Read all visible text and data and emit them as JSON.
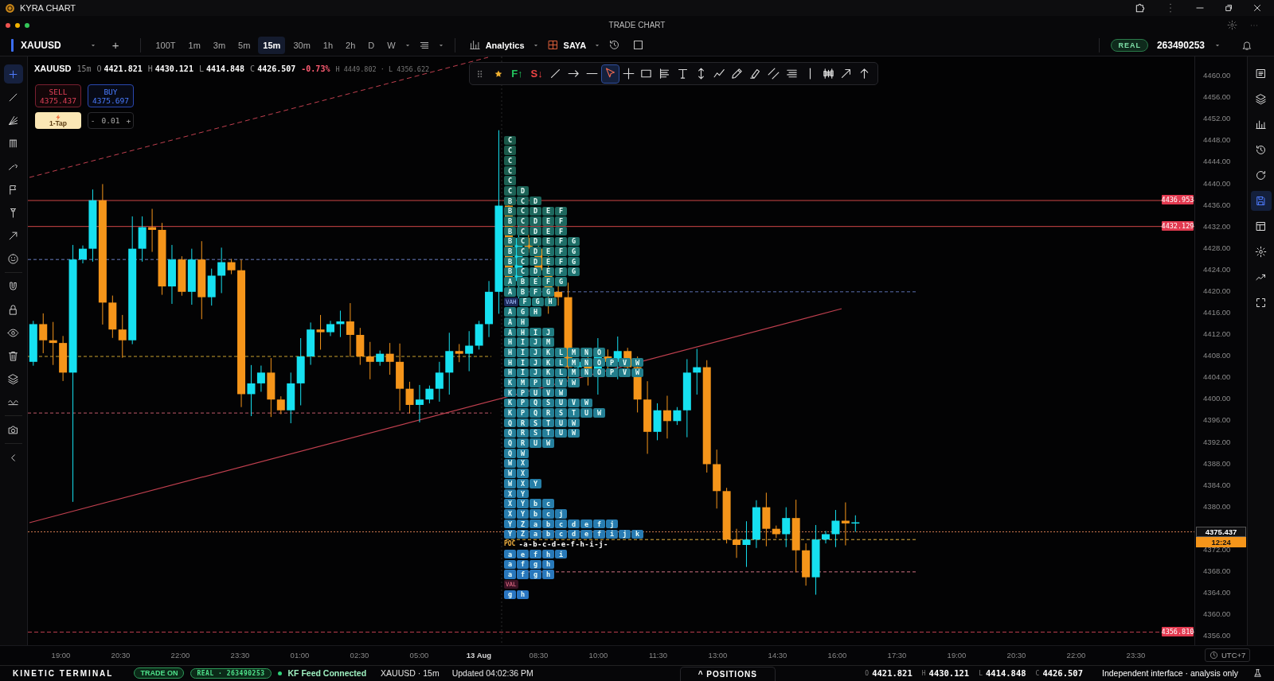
{
  "app_title": "KYRA CHART",
  "window_title": "TRADE CHART",
  "toolbar": {
    "symbol": "XAUUSD",
    "add": "+",
    "intervals": [
      {
        "label": "100T",
        "selected": false
      },
      {
        "label": "1m",
        "selected": false
      },
      {
        "label": "3m",
        "selected": false
      },
      {
        "label": "5m",
        "selected": false
      },
      {
        "label": "15m",
        "selected": true
      },
      {
        "label": "30m",
        "selected": false
      },
      {
        "label": "1h",
        "selected": false
      },
      {
        "label": "2h",
        "selected": false
      },
      {
        "label": "D",
        "selected": false
      },
      {
        "label": "W",
        "selected": false
      }
    ],
    "analytics": "Analytics",
    "layout_name": "SAYA",
    "account_badge": "REAL",
    "account_id": "263490253"
  },
  "left_tools": [
    {
      "selected": true
    },
    {
      "selected": false
    },
    {
      "selected": false
    },
    {
      "selected": false
    },
    {
      "selected": false
    },
    {
      "selected": false
    },
    {
      "selected": false
    },
    {
      "selected": false
    },
    {
      "selected": false
    },
    {
      "selected": false
    },
    {
      "selected": false
    },
    {
      "selected": false
    },
    {
      "selected": false
    },
    {
      "selected": false
    },
    {
      "selected": false
    },
    {
      "selected": false
    },
    {
      "selected": false
    }
  ],
  "right_tools": [
    {
      "selected": false
    },
    {
      "selected": false
    },
    {
      "selected": false
    },
    {
      "selected": false
    },
    {
      "selected": false
    },
    {
      "selected": true
    },
    {
      "selected": false
    },
    {
      "selected": false
    },
    {
      "selected": false
    },
    {
      "selected": false
    }
  ],
  "legend": {
    "symbol": "XAUUSD",
    "interval": "15m",
    "values": [
      {
        "key": "O",
        "value": "4421.821"
      },
      {
        "key": "H",
        "value": "4430.121"
      },
      {
        "key": "L",
        "value": "4414.848"
      },
      {
        "key": "C",
        "value": "4426.507"
      }
    ],
    "change": "-0.73%",
    "range": "H 4449.802 · L 4356.622"
  },
  "trade": {
    "sell_label": "SELL",
    "sell_price": "4375.437",
    "buy_label": "BUY",
    "buy_price": "4375.697",
    "one_tap": "1-Tap",
    "qty_minus": "-",
    "qty": "0.01",
    "qty_plus": "+"
  },
  "drawing_tools": [
    {
      "selected": false
    },
    {
      "label": "F↑",
      "color": "#22c55e",
      "selected": false
    },
    {
      "label": "S↓",
      "color": "#ef4444",
      "selected": false
    },
    {
      "selected": false
    },
    {
      "selected": false
    },
    {
      "selected": false
    },
    {
      "selected": true
    },
    {
      "selected": false
    },
    {
      "selected": false
    },
    {
      "selected": false
    },
    {
      "selected": false
    },
    {
      "selected": false
    },
    {
      "selected": false
    },
    {
      "selected": false
    },
    {
      "selected": false
    },
    {
      "selected": false
    },
    {
      "selected": false
    },
    {
      "selected": false
    },
    {
      "selected": false
    },
    {
      "selected": false
    },
    {
      "selected": false
    }
  ],
  "price_axis": {
    "ticks": [
      "4460.00",
      "4456.00",
      "4452.00",
      "4448.00",
      "4444.00",
      "4440.00",
      "4436.00",
      "4432.00",
      "4428.00",
      "4424.00",
      "4420.00",
      "4416.00",
      "4412.00",
      "4408.00",
      "4404.00",
      "4400.00",
      "4396.00",
      "4392.00",
      "4388.00",
      "4384.00",
      "4380.00",
      "4372.00",
      "4368.00",
      "4364.00",
      "4360.00",
      "4356.00"
    ]
  },
  "price_tags": [
    {
      "text": "4436.953"
    },
    {
      "text": "4432.129"
    },
    {
      "text": "4356.810"
    }
  ],
  "current_price": {
    "text": "4375.437",
    "countdown": "12:24"
  },
  "tpo": {
    "rows": [
      {
        "kind": "letters",
        "letters": [
          "C"
        ]
      },
      {
        "kind": "letters",
        "letters": [
          "C"
        ]
      },
      {
        "kind": "letters",
        "letters": [
          "C"
        ]
      },
      {
        "kind": "letters",
        "letters": [
          "C"
        ]
      },
      {
        "kind": "letters",
        "letters": [
          "C"
        ]
      },
      {
        "kind": "letters",
        "letters": [
          "C",
          "D"
        ]
      },
      {
        "kind": "letters",
        "letters": [
          "B",
          "C",
          "D"
        ]
      },
      {
        "kind": "letters",
        "letters": [
          "B",
          "C",
          "D",
          "E",
          "F"
        ]
      },
      {
        "kind": "letters",
        "letters": [
          "B",
          "C",
          "D",
          "E",
          "F"
        ]
      },
      {
        "kind": "letters",
        "letters": [
          "B",
          "C",
          "D",
          "E",
          "F"
        ]
      },
      {
        "kind": "letters",
        "letters": [
          "B",
          "C",
          "D",
          "E",
          "F",
          "G"
        ]
      },
      {
        "kind": "letters",
        "letters": [
          "B",
          "C",
          "D",
          "E",
          "F",
          "G"
        ]
      },
      {
        "kind": "letters",
        "letters": [
          "B",
          "C",
          "D",
          "E",
          "F",
          "G"
        ]
      },
      {
        "kind": "letters",
        "letters": [
          "B",
          "C",
          "D",
          "E",
          "F",
          "G"
        ]
      },
      {
        "kind": "letters",
        "letters": [
          "A",
          "B",
          "E",
          "F",
          "G"
        ]
      },
      {
        "kind": "letters",
        "letters": [
          "A",
          "B",
          "F",
          "G"
        ]
      },
      {
        "kind": "letters",
        "tag": "VAH",
        "letters": [
          "F",
          "G",
          "H"
        ]
      },
      {
        "kind": "letters",
        "letters": [
          "A",
          "G",
          "H"
        ]
      },
      {
        "kind": "letters",
        "letters": [
          "A",
          "H"
        ]
      },
      {
        "kind": "letters",
        "letters": [
          "A",
          "H",
          "I",
          "J"
        ]
      },
      {
        "kind": "letters",
        "letters": [
          "H",
          "I",
          "J",
          "M"
        ]
      },
      {
        "kind": "letters",
        "letters": [
          "H",
          "I",
          "J",
          "K",
          "L",
          "M",
          "N",
          "O"
        ]
      },
      {
        "kind": "letters",
        "letters": [
          "H",
          "I",
          "J",
          "K",
          "L",
          "M",
          "N",
          "O",
          "P",
          "V",
          "W"
        ]
      },
      {
        "kind": "letters",
        "letters": [
          "H",
          "I",
          "J",
          "K",
          "L",
          "M",
          "N",
          "O",
          "P",
          "V",
          "W"
        ]
      },
      {
        "kind": "letters",
        "letters": [
          "K",
          "M",
          "P",
          "U",
          "V",
          "W"
        ]
      },
      {
        "kind": "letters",
        "letters": [
          "K",
          "P",
          "U",
          "V",
          "W"
        ]
      },
      {
        "kind": "letters",
        "letters": [
          "K",
          "P",
          "Q",
          "S",
          "U",
          "V",
          "W"
        ]
      },
      {
        "kind": "letters",
        "letters": [
          "K",
          "P",
          "Q",
          "R",
          "S",
          "T",
          "U",
          "W"
        ]
      },
      {
        "kind": "letters",
        "letters": [
          "Q",
          "R",
          "S",
          "T",
          "U",
          "W"
        ]
      },
      {
        "kind": "letters",
        "letters": [
          "Q",
          "R",
          "S",
          "T",
          "U",
          "W"
        ]
      },
      {
        "kind": "letters",
        "letters": [
          "Q",
          "R",
          "U",
          "W"
        ]
      },
      {
        "kind": "letters",
        "letters": [
          "Q",
          "W"
        ]
      },
      {
        "kind": "letters",
        "letters": [
          "W",
          "X"
        ]
      },
      {
        "kind": "letters",
        "letters": [
          "W",
          "X"
        ]
      },
      {
        "kind": "letters",
        "letters": [
          "W",
          "X",
          "Y"
        ]
      },
      {
        "kind": "letters",
        "letters": [
          "X",
          "Y"
        ]
      },
      {
        "kind": "letters",
        "letters": [
          "X",
          "Y",
          "b",
          "c"
        ]
      },
      {
        "kind": "letters",
        "letters": [
          "X",
          "Y",
          "b",
          "c",
          "j"
        ]
      },
      {
        "kind": "letters",
        "letters": [
          "Y",
          "Z",
          "a",
          "b",
          "c",
          "d",
          "e",
          "f",
          "j"
        ]
      },
      {
        "kind": "letters",
        "letters": [
          "Y",
          "Z",
          "a",
          "b",
          "c",
          "d",
          "e",
          "f",
          "i",
          "j",
          "k"
        ]
      },
      {
        "kind": "poc",
        "tag": "POC",
        "text": "-a-b-c-d-e-f-h-i-j-"
      },
      {
        "kind": "letters",
        "letters": [
          "a",
          "e",
          "f",
          "h",
          "i"
        ]
      },
      {
        "kind": "letters",
        "letters": [
          "a",
          "f",
          "g",
          "h"
        ]
      },
      {
        "kind": "letters",
        "letters": [
          "a",
          "f",
          "g",
          "h"
        ]
      },
      {
        "kind": "letters",
        "tag": "VAL",
        "letters": []
      },
      {
        "kind": "letters",
        "letters": [
          "g",
          "h"
        ]
      }
    ]
  },
  "time_axis": {
    "labels": [
      {
        "text": "19:00",
        "bold": false
      },
      {
        "text": "20:30",
        "bold": false
      },
      {
        "text": "22:00",
        "bold": false
      },
      {
        "text": "23:30",
        "bold": false
      },
      {
        "text": "01:00",
        "bold": false
      },
      {
        "text": "02:30",
        "bold": false
      },
      {
        "text": "05:00",
        "bold": false
      },
      {
        "text": "13 Aug",
        "bold": true
      },
      {
        "text": "08:30",
        "bold": false
      },
      {
        "text": "10:00",
        "bold": false
      },
      {
        "text": "11:30",
        "bold": false
      },
      {
        "text": "13:00",
        "bold": false
      },
      {
        "text": "14:30",
        "bold": false
      },
      {
        "text": "16:00",
        "bold": false
      },
      {
        "text": "17:30",
        "bold": false
      },
      {
        "text": "19:00",
        "bold": false
      },
      {
        "text": "20:30",
        "bold": false
      },
      {
        "text": "22:00",
        "bold": false
      },
      {
        "text": "23:30",
        "bold": false
      }
    ],
    "timezone": "UTC+7"
  },
  "status": {
    "brand": "KINETIC TERMINAL",
    "trade_state": "TRADE ON",
    "account": "REAL · 263490253",
    "feed": "KF Feed Connected",
    "symbol": "XAUUSD · 15m",
    "updated": "Updated 04:02:36 PM",
    "positions": "^ POSITIONS",
    "ohlc": [
      {
        "key": "O",
        "value": "4421.821"
      },
      {
        "key": "H",
        "value": "4430.121"
      },
      {
        "key": "L",
        "value": "4414.848"
      },
      {
        "key": "C",
        "value": "4426.507"
      }
    ],
    "note": "Independent interface · analysis only"
  }
}
